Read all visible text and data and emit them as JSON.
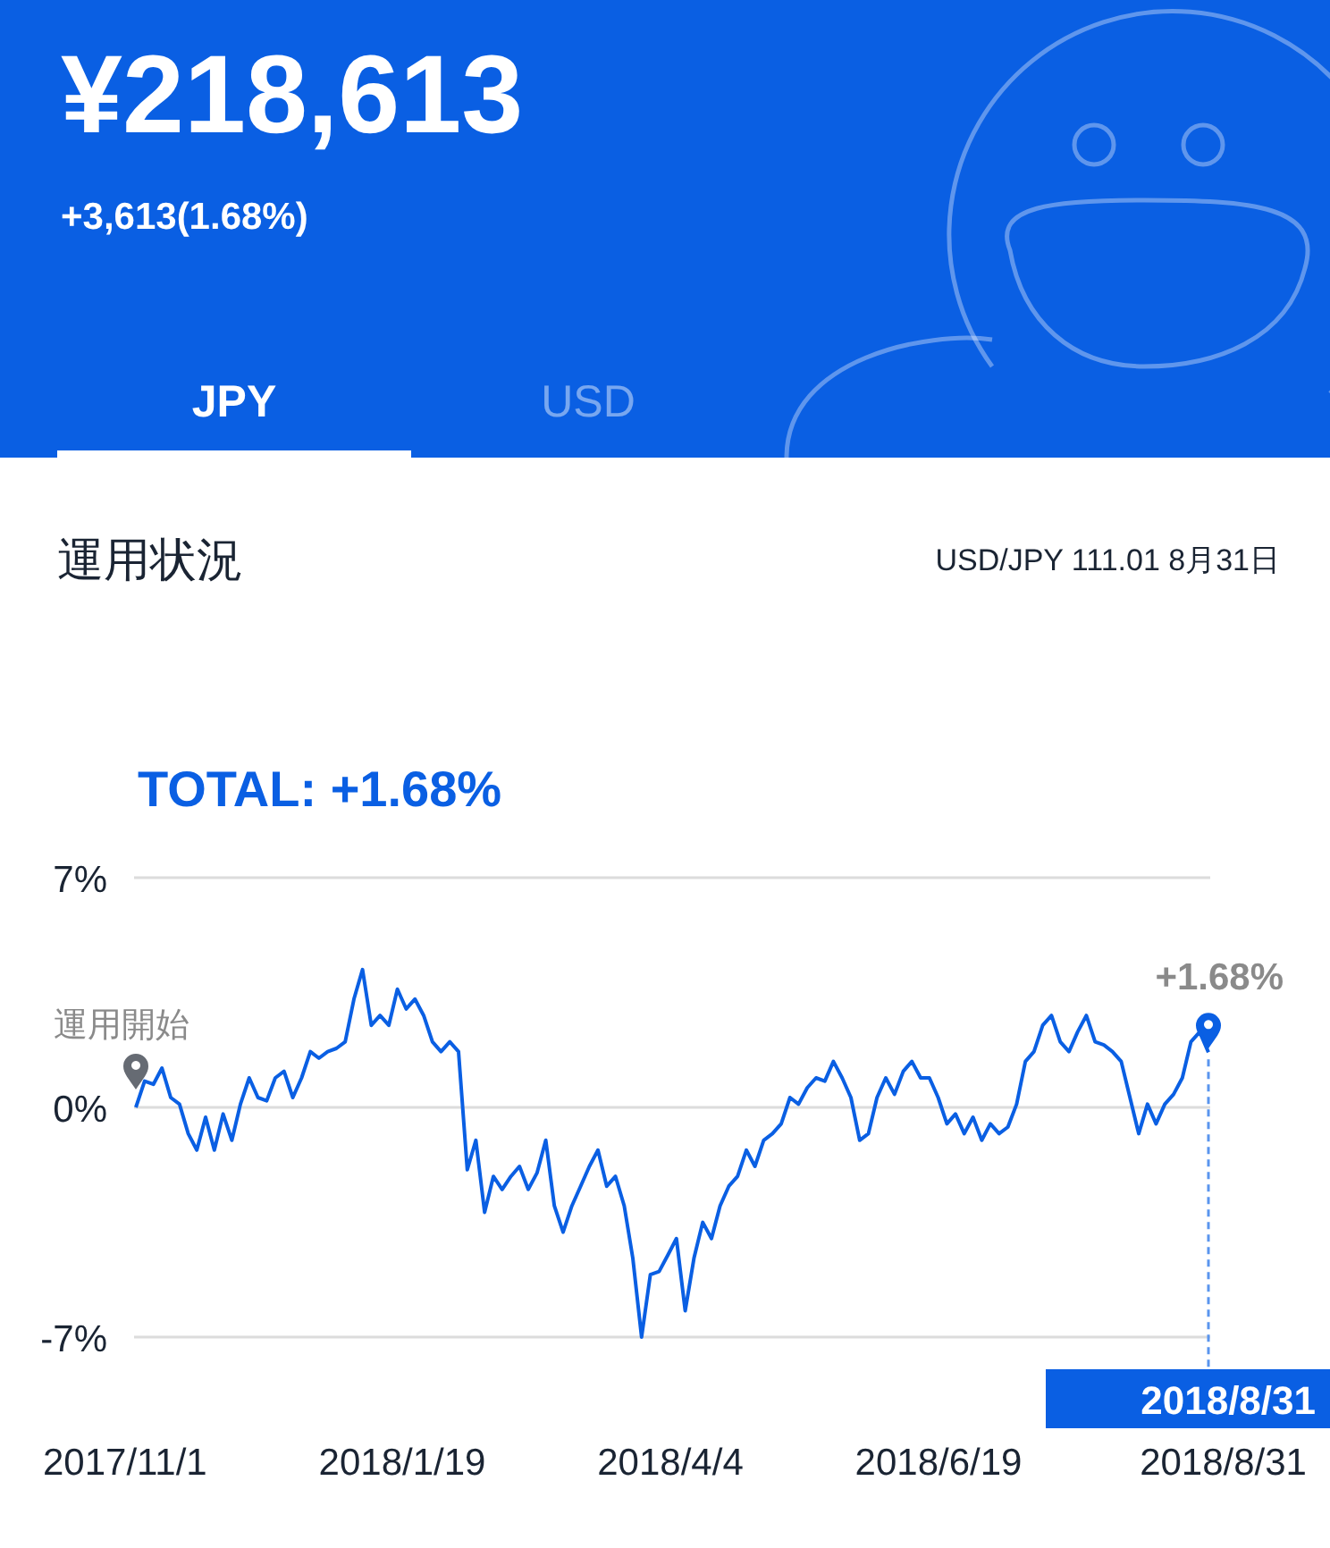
{
  "balance": {
    "amount": "¥218,613",
    "change": "+3,613(1.68%)"
  },
  "tabs": [
    {
      "label": "JPY",
      "selected": true
    },
    {
      "label": "USD",
      "selected": false
    }
  ],
  "section": {
    "title": "運用状況",
    "rate": "USD/JPY 111.01 8月31日"
  },
  "total": "TOTAL: +1.68%",
  "chart": {
    "start_label": "運用開始",
    "end_label": "+1.68%",
    "cursor_label": "2018/8/31",
    "x_labels": [
      "2017/11/1",
      "2018/1/19",
      "2018/4/4",
      "2018/6/19",
      "2018/8/31"
    ],
    "chart_data": {
      "type": "line",
      "ylim": [
        -7,
        7
      ],
      "yticks": [
        {
          "value": 7,
          "label": "7%"
        },
        {
          "value": 0,
          "label": "0%"
        },
        {
          "value": -7,
          "label": "-7%"
        }
      ],
      "series": [
        {
          "color": "#0a5fe3",
          "values": [
            0,
            0.8,
            0.7,
            1.2,
            0.3,
            0.1,
            -0.8,
            -1.3,
            -0.3,
            -1.3,
            -0.2,
            -1.0,
            0.1,
            0.9,
            0.3,
            0.2,
            0.9,
            1.1,
            0.3,
            0.9,
            1.7,
            1.5,
            1.7,
            1.8,
            2.0,
            3.3,
            4.2,
            2.5,
            2.8,
            2.5,
            3.6,
            3.0,
            3.3,
            2.8,
            2.0,
            1.7,
            2.0,
            1.7,
            -1.9,
            -1.0,
            -3.2,
            -2.1,
            -2.5,
            -2.1,
            -1.8,
            -2.5,
            -2.0,
            -1.0,
            -3.0,
            -3.8,
            -3.0,
            -2.4,
            -1.8,
            -1.3,
            -2.4,
            -2.1,
            -3.0,
            -4.6,
            -7.0,
            -5.1,
            -5.0,
            -4.5,
            -4.0,
            -6.2,
            -4.6,
            -3.5,
            -4.0,
            -3.0,
            -2.4,
            -2.1,
            -1.3,
            -1.8,
            -1.0,
            -0.8,
            -0.5,
            0.3,
            0.1,
            0.6,
            0.9,
            0.8,
            1.4,
            0.9,
            0.3,
            -1.0,
            -0.8,
            0.3,
            0.9,
            0.4,
            1.1,
            1.4,
            0.9,
            0.9,
            0.3,
            -0.5,
            -0.2,
            -0.8,
            -0.3,
            -1.0,
            -0.5,
            -0.8,
            -0.6,
            0.1,
            1.4,
            1.7,
            2.5,
            2.8,
            2.0,
            1.7,
            2.3,
            2.8,
            2.0,
            1.9,
            1.7,
            1.4,
            0.3,
            -0.8,
            0.1,
            -0.5,
            0.1,
            0.4,
            0.9,
            2.0,
            2.3,
            1.68
          ]
        }
      ]
    }
  }
}
